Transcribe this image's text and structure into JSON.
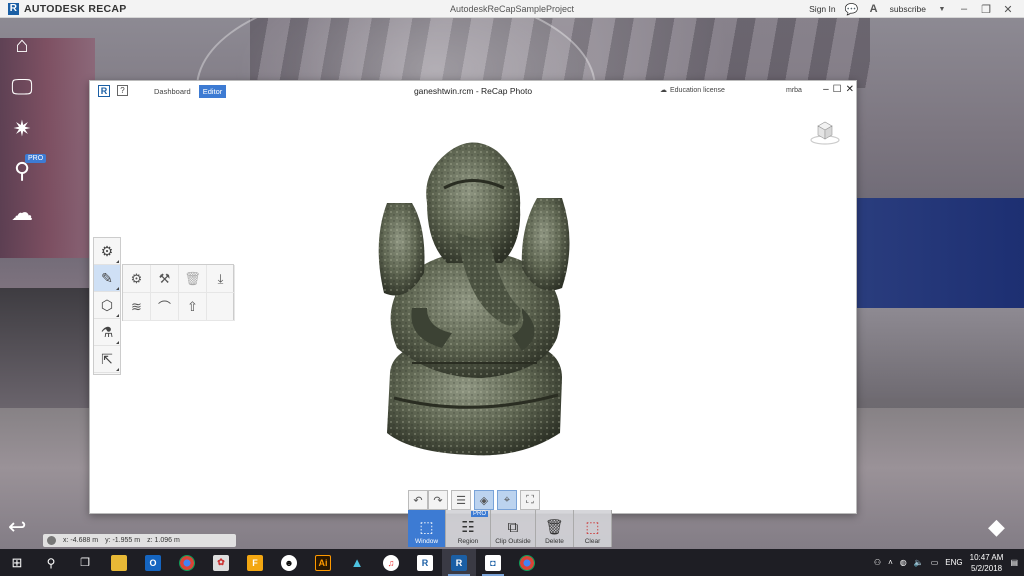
{
  "app": {
    "brand": "AUTODESK RECAP",
    "window_title": "AutodeskReCapSampleProject",
    "sign_in": "Sign In",
    "subscribe": "subscribe"
  },
  "rail": {
    "pro_badge": "PRO"
  },
  "coords": {
    "x_label": "x:",
    "x_value": "-4.688",
    "x_unit": "m",
    "y_label": "y:",
    "y_value": "-1.955",
    "y_unit": "m",
    "z_label": "z:",
    "z_value": "1.096",
    "z_unit": "m"
  },
  "editor": {
    "tabs": [
      {
        "label": "Dashboard"
      },
      {
        "label": "Editor"
      }
    ],
    "title": "ganeshtwin.rcm - ReCap Photo",
    "education": "Education license",
    "user": "mrba",
    "help": "?"
  },
  "selection_tools": [
    {
      "label": "Window"
    },
    {
      "label": "Region"
    },
    {
      "label": "Clip Outside"
    },
    {
      "label": "Delete"
    },
    {
      "label": "Clear"
    }
  ],
  "region_badge": "PRO",
  "taskbar": {
    "language": "ENG",
    "time": "10:47 AM",
    "date": "5/2/2018"
  }
}
